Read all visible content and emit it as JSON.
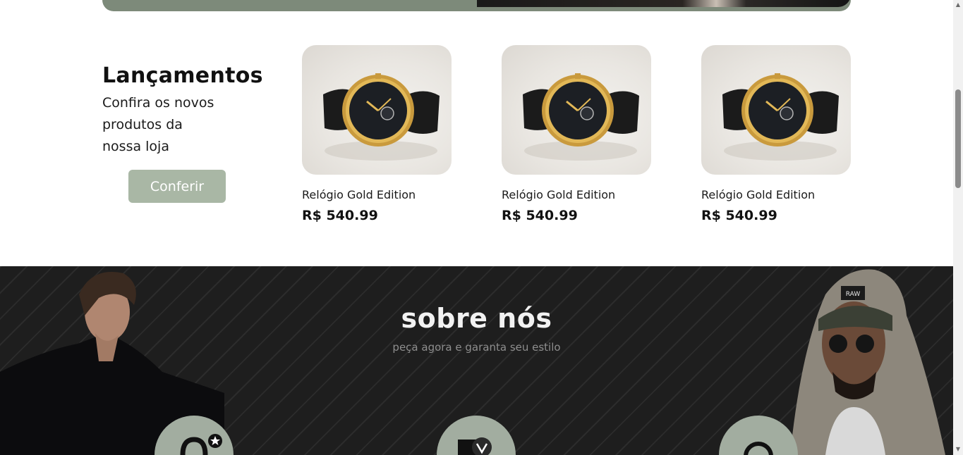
{
  "launch": {
    "title": "Lançamentos",
    "subtitle": "Confira os novos produtos da nossa loja",
    "cta_label": "Conferir"
  },
  "products": [
    {
      "name": "Relógio Gold Edition",
      "price": "R$ 540.99",
      "image_icon": "gold-watch-image"
    },
    {
      "name": "Relógio Gold Edition",
      "price": "R$ 540.99",
      "image_icon": "gold-watch-image"
    },
    {
      "name": "Relógio Gold Edition",
      "price": "R$ 540.99",
      "image_icon": "gold-watch-image"
    }
  ],
  "about": {
    "title": "sobre nós",
    "subtitle": "peça agora e garanta seu estilo",
    "feature_icons": [
      "watch-star-icon",
      "shield-v-icon",
      "magnifier-icon"
    ]
  },
  "colors": {
    "accent": "#a9b7a5",
    "banner": "#7d8a7a",
    "dark_section": "#1e1e1e",
    "pill": "#a2ada0"
  }
}
